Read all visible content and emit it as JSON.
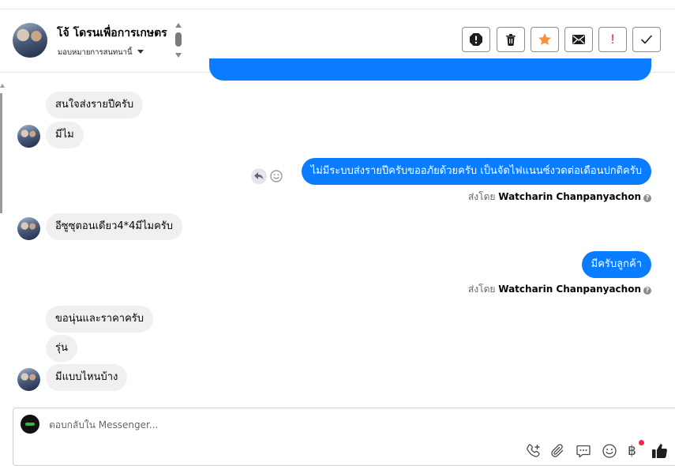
{
  "header": {
    "contact_name": "โจ้ โดรนเพื่อการเกษตร",
    "assign_label": "มอบหมายการสนทนานี้",
    "actions": [
      {
        "icon": "spam-icon"
      },
      {
        "icon": "trash-icon"
      },
      {
        "icon": "star-icon",
        "color": "#f7923a"
      },
      {
        "icon": "mail-icon"
      },
      {
        "icon": "follow-up-icon",
        "text": "!",
        "color": "#e41e3f"
      },
      {
        "icon": "check-icon"
      }
    ]
  },
  "messages": [
    {
      "from": "customer",
      "text": "สนใจส่งรายปีครับ"
    },
    {
      "from": "customer",
      "text": "มีไม"
    },
    {
      "from": "page",
      "text": "ไม่มีระบบส่งรายปีครับขออภัยด้วยครับ เป็นจัดไฟแนนซ์งวดต่อเดือนปกติครับ",
      "sent_by_label": "ส่งโดย",
      "sent_by": "Watcharin Chanpanyachon"
    },
    {
      "from": "customer",
      "text": "อีซูซุตอนเดียว4*4มีไมครับ"
    },
    {
      "from": "page",
      "text": "มีครับลูกค้า",
      "sent_by_label": "ส่งโดย",
      "sent_by": "Watcharin Chanpanyachon"
    },
    {
      "from": "customer",
      "text": "ขอนุ่นและราคาครับ"
    },
    {
      "from": "customer",
      "text": "รุ่น"
    },
    {
      "from": "customer",
      "text": "มีแบบไหนบ้าง"
    }
  ],
  "composer": {
    "placeholder": "ตอบกลับใน Messenger...",
    "tools": [
      "call-add-icon",
      "attachment-icon",
      "saved-reply-icon",
      "emoji-icon",
      "baht-payment-icon",
      "like-icon"
    ],
    "baht_symbol": "฿"
  },
  "colors": {
    "outgoing_bubble": "#0a7cff",
    "incoming_bubble": "#f0f0f0",
    "star": "#f7923a",
    "alert": "#e41e3f"
  }
}
